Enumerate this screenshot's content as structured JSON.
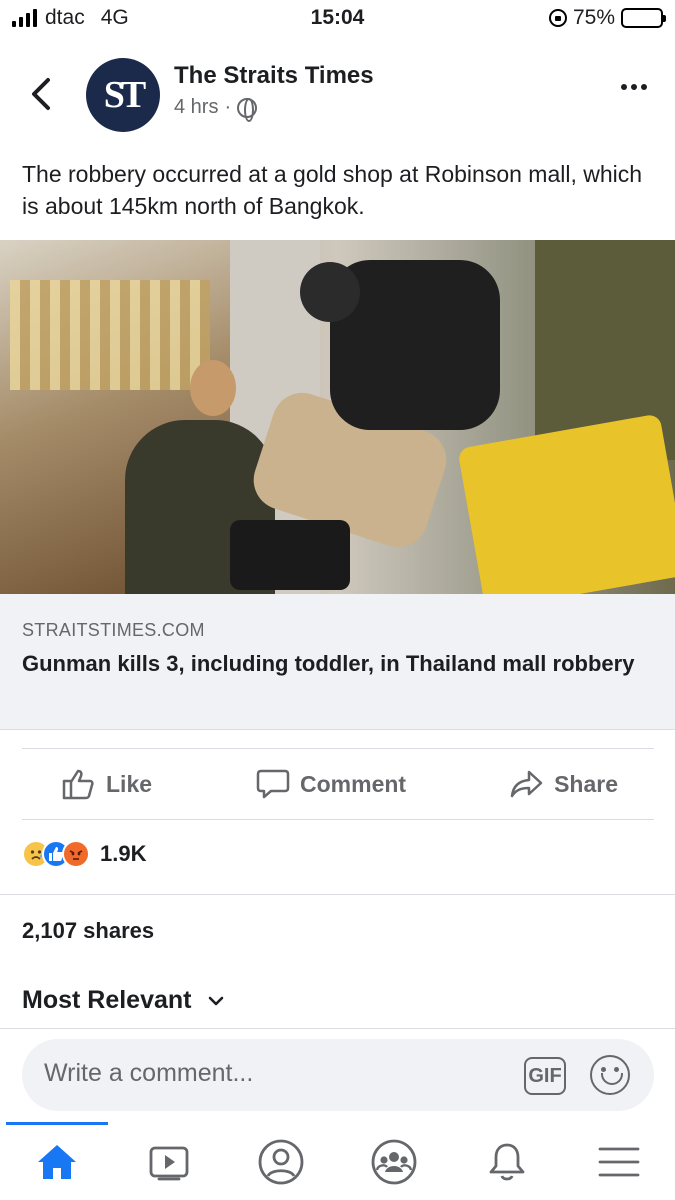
{
  "status_bar": {
    "carrier": "dtac",
    "network": "4G",
    "time": "15:04",
    "battery": "75%",
    "battery_level": 0.75
  },
  "post": {
    "page_name": "The Straits Times",
    "avatar_text": "ST",
    "time_ago": "4 hrs",
    "separator": "·",
    "text": "The robbery occurred at a gold shop at Robinson mall, which is about 145km north of Bangkok."
  },
  "link": {
    "domain": "STRAITSTIMES.COM",
    "title": "Gunman kills 3, including toddler, in Thailand mall robbery"
  },
  "actions": {
    "like": "Like",
    "comment": "Comment",
    "share": "Share"
  },
  "reactions": {
    "count": "1.9K",
    "types": [
      "sad",
      "like",
      "angry"
    ]
  },
  "shares": "2,107 shares",
  "sort": "Most Relevant",
  "comment_box": {
    "placeholder": "Write a comment...",
    "gif_label": "GIF"
  },
  "tabs": [
    "home-icon",
    "video-icon",
    "profile-icon",
    "groups-icon",
    "notifications-icon",
    "menu-icon"
  ],
  "colors": {
    "accent": "#1877f2",
    "secondary_text": "#65676b",
    "card_bg": "#f0f2f5"
  }
}
